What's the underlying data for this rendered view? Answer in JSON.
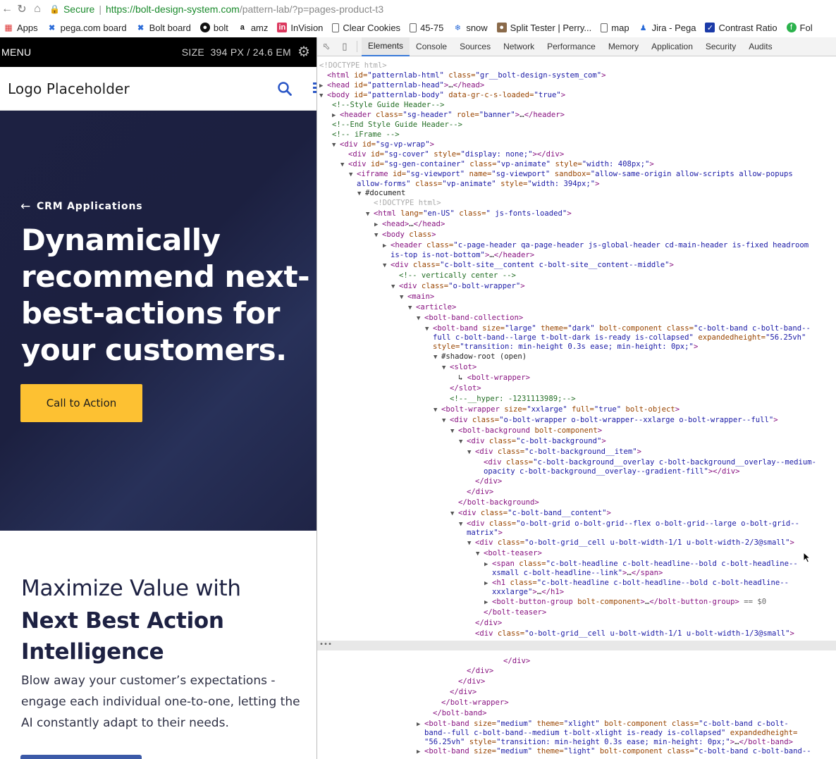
{
  "browser": {
    "secure_label": "Secure",
    "url_host": "https://bolt-design-system.com",
    "url_path": "/pattern-lab/?p=pages-product-t3",
    "bookmarks": [
      {
        "label": "Apps",
        "icon": "apps-grid-icon"
      },
      {
        "label": "pega.com board",
        "icon": "jira-icon"
      },
      {
        "label": "Bolt board",
        "icon": "jira-icon"
      },
      {
        "label": "bolt",
        "icon": "github-icon"
      },
      {
        "label": "amz",
        "icon": "amazon-icon"
      },
      {
        "label": "InVision",
        "icon": "invision-icon"
      },
      {
        "label": "Clear Cookies",
        "icon": "page-icon"
      },
      {
        "label": "45-75",
        "icon": "page-icon"
      },
      {
        "label": "snow",
        "icon": "snow-icon"
      },
      {
        "label": "Split Tester | Perry...",
        "icon": "avatar-icon"
      },
      {
        "label": "map",
        "icon": "page-icon"
      },
      {
        "label": "Jira - Pega",
        "icon": "jira-person-icon"
      },
      {
        "label": "Contrast Ratio",
        "icon": "checkbox-icon"
      },
      {
        "label": "Fol",
        "icon": "feedly-icon"
      }
    ]
  },
  "patternlab": {
    "menu_label": "MENU",
    "size_label": "SIZE",
    "size_value": "394 PX / 24.6 EM"
  },
  "site": {
    "logo": "Logo Placeholder",
    "hero": {
      "eyebrow": "CRM Applications",
      "title": "Dynamically recommend next-best-actions for your customers.",
      "cta": "Call to Action"
    },
    "section2": {
      "headline_light": "Maximize Value with",
      "headline_bold": "Next Best Action Intelligence",
      "body": "Blow away your customer’s expectations - engage each individual one-to-one, letting the AI constantly adapt to their needs."
    }
  },
  "devtools": {
    "tabs": [
      "Elements",
      "Console",
      "Sources",
      "Network",
      "Performance",
      "Memory",
      "Application",
      "Security",
      "Audits"
    ],
    "active_tab": "Elements",
    "selected_suffix": "== $0"
  },
  "colors": {
    "hero_bg": "#1d2142",
    "cta_bg": "#fdc132",
    "secure_green": "#1a8a2c",
    "devtools_active": "#3879d9"
  }
}
